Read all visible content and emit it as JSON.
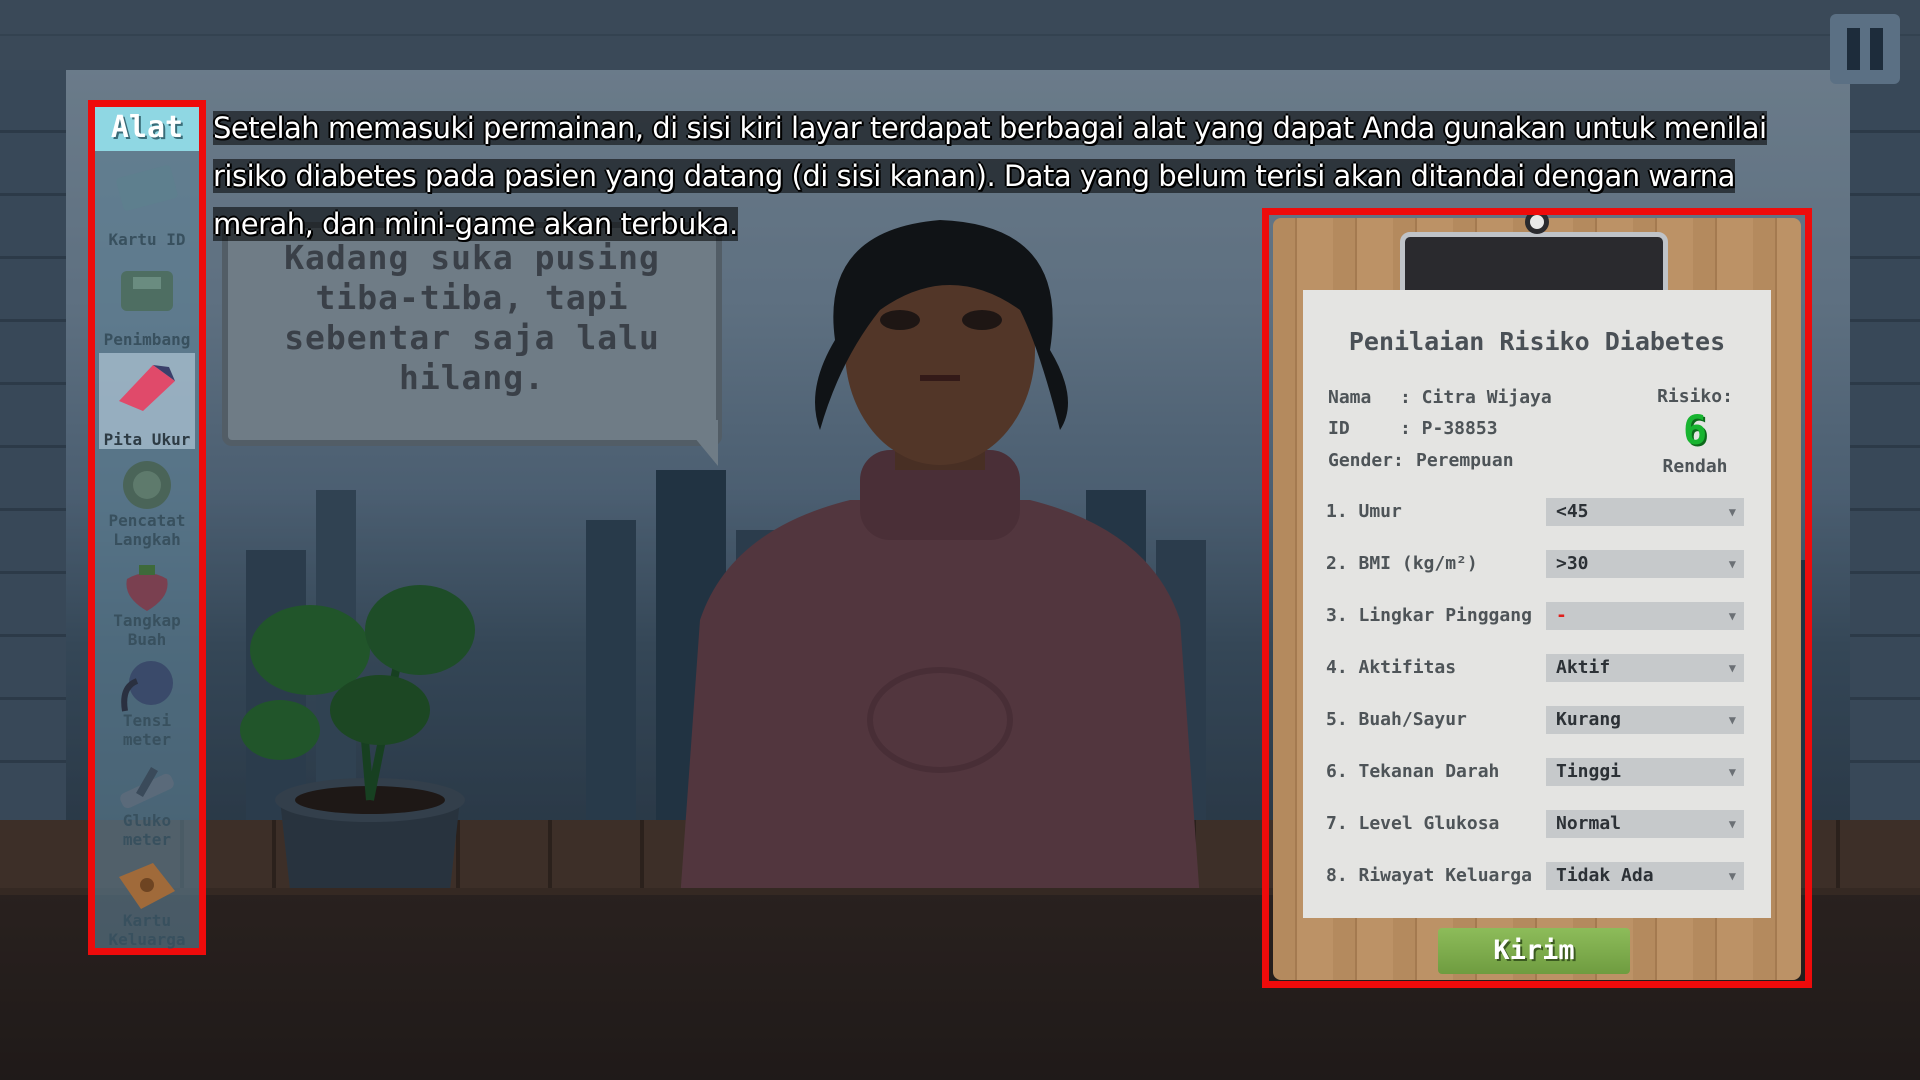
{
  "tutorial": {
    "lines": [
      "Setelah memasuki permainan, di sisi kiri layar terdapat berbagai alat yang dapat Anda gunakan untuk menilai",
      "risiko diabetes pada pasien yang datang (di sisi kanan). Data yang belum terisi akan ditandai dengan warna",
      "merah, dan mini-game akan terbuka."
    ]
  },
  "speech": {
    "text": "Kadang suka pusing tiba-tiba, tapi sebentar saja lalu hilang."
  },
  "tools": {
    "header": "Alat",
    "items": [
      {
        "label": "Kartu ID",
        "icon": "id-card-icon"
      },
      {
        "label": "Penimbang",
        "icon": "scale-icon"
      },
      {
        "label": "Pita Ukur",
        "icon": "measuring-tape-icon"
      },
      {
        "label": "Pencatat Langkah",
        "icon": "step-counter-icon"
      },
      {
        "label": "Tangkap Buah",
        "icon": "fruit-catch-icon"
      },
      {
        "label": "Tensi meter",
        "icon": "blood-pressure-icon"
      },
      {
        "label": "Gluko meter",
        "icon": "glucometer-icon"
      },
      {
        "label": "Kartu Keluarga",
        "icon": "family-card-icon"
      }
    ]
  },
  "form": {
    "title": "Penilaian Risiko Diabetes",
    "name_label": "Nama",
    "name_value": ": Citra Wijaya",
    "id_label": "ID",
    "id_value": ": P-38853",
    "gender_label": "Gender:",
    "gender_value": "Perempuan",
    "risk_label": "Risiko:",
    "risk_value": "6",
    "risk_level": "Rendah",
    "questions": [
      {
        "label": "1. Umur",
        "value": "<45"
      },
      {
        "label": "2. BMI (kg/m²)",
        "value": ">30"
      },
      {
        "label": "3. Lingkar Pinggang",
        "value": "-"
      },
      {
        "label": "4. Aktifitas",
        "value": "Aktif"
      },
      {
        "label": "5. Buah/Sayur",
        "value": "Kurang"
      },
      {
        "label": "6. Tekanan Darah",
        "value": "Tinggi"
      },
      {
        "label": "7. Level Glukosa",
        "value": "Normal"
      },
      {
        "label": "8. Riwayat Keluarga",
        "value": "Tidak Ada"
      }
    ],
    "submit_label": "Kirim"
  },
  "colors": {
    "highlight": "#ee0b0b",
    "risk_green": "#18b430",
    "missing_red": "#e0201c"
  }
}
